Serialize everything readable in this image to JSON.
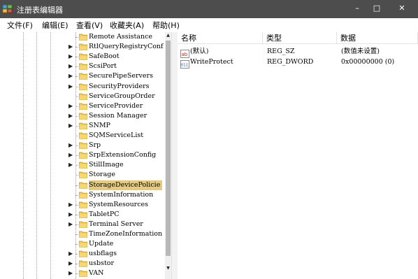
{
  "window": {
    "title": "注册表编辑器",
    "minimize_glyph": "–",
    "maximize_glyph": "□",
    "close_glyph": "✕",
    "titlebar_color": "#4d4d4d",
    "selection_color": "#e6cc7a"
  },
  "menu": [
    {
      "label": "文件(F)"
    },
    {
      "label": "编辑(E)"
    },
    {
      "label": "查看(V)"
    },
    {
      "label": "收藏夹(A)"
    },
    {
      "label": "帮助(H)"
    }
  ],
  "tree": {
    "items": [
      {
        "label": "Remote Assistance",
        "has_children": false,
        "selected": false
      },
      {
        "label": "RtlQueryRegistryConf",
        "has_children": true,
        "selected": false
      },
      {
        "label": "SafeBoot",
        "has_children": true,
        "selected": false
      },
      {
        "label": "ScsiPort",
        "has_children": true,
        "selected": false
      },
      {
        "label": "SecurePipeServers",
        "has_children": true,
        "selected": false
      },
      {
        "label": "SecurityProviders",
        "has_children": true,
        "selected": false
      },
      {
        "label": "ServiceGroupOrder",
        "has_children": false,
        "selected": false
      },
      {
        "label": "ServiceProvider",
        "has_children": true,
        "selected": false
      },
      {
        "label": "Session Manager",
        "has_children": true,
        "selected": false
      },
      {
        "label": "SNMP",
        "has_children": true,
        "selected": false
      },
      {
        "label": "SQMServiceList",
        "has_children": false,
        "selected": false
      },
      {
        "label": "Srp",
        "has_children": true,
        "selected": false
      },
      {
        "label": "SrpExtensionConfig",
        "has_children": true,
        "selected": false
      },
      {
        "label": "StillImage",
        "has_children": true,
        "selected": false
      },
      {
        "label": "Storage",
        "has_children": false,
        "selected": false
      },
      {
        "label": "StorageDevicePolicie",
        "has_children": false,
        "selected": true
      },
      {
        "label": "SystemInformation",
        "has_children": false,
        "selected": false
      },
      {
        "label": "SystemResources",
        "has_children": true,
        "selected": false
      },
      {
        "label": "TabletPC",
        "has_children": true,
        "selected": false
      },
      {
        "label": "Terminal Server",
        "has_children": true,
        "selected": false
      },
      {
        "label": "TimeZoneInformation",
        "has_children": false,
        "selected": false
      },
      {
        "label": "Update",
        "has_children": false,
        "selected": false
      },
      {
        "label": "usbflags",
        "has_children": true,
        "selected": false
      },
      {
        "label": "usbstor",
        "has_children": true,
        "selected": false
      },
      {
        "label": "VAN",
        "has_children": true,
        "selected": false
      }
    ],
    "expand_arrow": "▶",
    "scroll_up_glyph": "▲",
    "scroll_down_glyph": "▼"
  },
  "values_pane": {
    "columns": [
      {
        "label": "名称"
      },
      {
        "label": "类型"
      },
      {
        "label": "数据"
      }
    ],
    "rows": [
      {
        "icon": "string-value-icon",
        "icon_text": "ab",
        "name": "(默认)",
        "type": "REG_SZ",
        "data": "(数值未设置)"
      },
      {
        "icon": "binary-value-icon",
        "icon_text": "011",
        "name": "WriteProtect",
        "type": "REG_DWORD",
        "data": "0x00000000 (0)"
      }
    ]
  }
}
